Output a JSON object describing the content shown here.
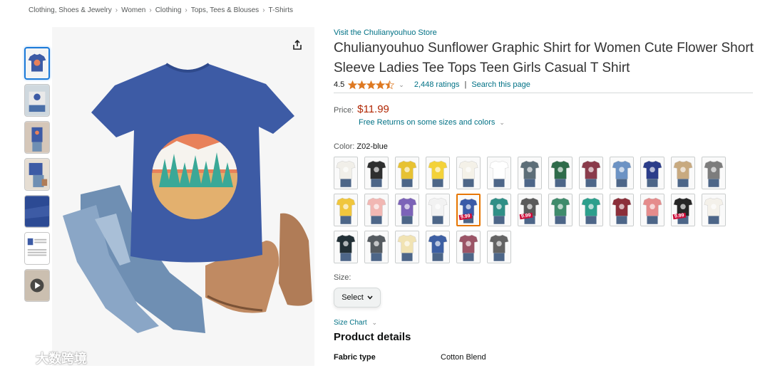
{
  "breadcrumb": [
    "Clothing, Shoes & Jewelry",
    "Women",
    "Clothing",
    "Tops, Tees & Blouses",
    "T-Shirts"
  ],
  "breadcrumb_sep": "›",
  "product": {
    "store_link": "Visit the Chulianyouhuo Store",
    "title": "Chulianyouhuo Sunflower Graphic Shirt for Women Cute Flower Short Sleeve Ladies Tee Tops Teen Girls Casual T Shirt",
    "rating": "4.5",
    "ratings_count": "2,448 ratings",
    "search_page": "Search this page",
    "price_label": "Price:",
    "price": "$11.99",
    "returns": "Free Returns on some sizes and colors",
    "color_label": "Color:",
    "color_value": "Z02-blue",
    "size_label": "Size:",
    "select_label": "Select",
    "size_chart": "Size Chart",
    "details_heading": "Product details",
    "details": [
      {
        "key": "Fabric type",
        "value": "Cotton Blend"
      }
    ]
  },
  "thumbnails": [
    "shirt-blue",
    "shirt-printed",
    "shirt-model",
    "shirt-outfit",
    "fabric",
    "size-chart",
    "video"
  ],
  "swatches": [
    {
      "color": "#f1efe9",
      "tag": ""
    },
    {
      "color": "#2e2f2f",
      "tag": ""
    },
    {
      "color": "#e7c233",
      "tag": ""
    },
    {
      "color": "#f3d23a",
      "tag": ""
    },
    {
      "color": "#f4f1e8",
      "tag": ""
    },
    {
      "color": "#ffffff",
      "tag": ""
    },
    {
      "color": "#5d6e78",
      "tag": ""
    },
    {
      "color": "#2f6b4a",
      "tag": ""
    },
    {
      "color": "#8a3b4b",
      "tag": ""
    },
    {
      "color": "#6d93c4",
      "tag": ""
    },
    {
      "color": "#2b3d8a",
      "tag": ""
    },
    {
      "color": "#c8aa80",
      "tag": ""
    },
    {
      "color": "#7d7d7d",
      "tag": ""
    },
    {
      "color": "#f0c63d",
      "tag": ""
    },
    {
      "color": "#f1b7b3",
      "tag": ""
    },
    {
      "color": "#7c63b8",
      "tag": ""
    },
    {
      "color": "#f2f2f2",
      "tag": ""
    },
    {
      "color": "#3a5aa8",
      "tag": "9.99"
    },
    {
      "color": "#2f8f86",
      "tag": ""
    },
    {
      "color": "#5a5a5a",
      "tag": "9.99"
    },
    {
      "color": "#3f8b6b",
      "tag": ""
    },
    {
      "color": "#2c9f8c",
      "tag": ""
    },
    {
      "color": "#8b2f3a",
      "tag": ""
    },
    {
      "color": "#e58c8c",
      "tag": ""
    },
    {
      "color": "#262626",
      "tag": "9.99"
    },
    {
      "color": "#f4f1ea",
      "tag": ""
    },
    {
      "color": "#223036",
      "tag": ""
    },
    {
      "color": "#555b60",
      "tag": ""
    },
    {
      "color": "#f1e3b3",
      "tag": ""
    },
    {
      "color": "#3d5fa3",
      "tag": ""
    },
    {
      "color": "#9b5466",
      "tag": ""
    },
    {
      "color": "#636363",
      "tag": ""
    }
  ],
  "selected_swatch": 17,
  "watermark": "大数跨境",
  "colors": {
    "link": "#007185",
    "price": "#b12704",
    "selected": "#e77600",
    "star": "#de7921"
  }
}
